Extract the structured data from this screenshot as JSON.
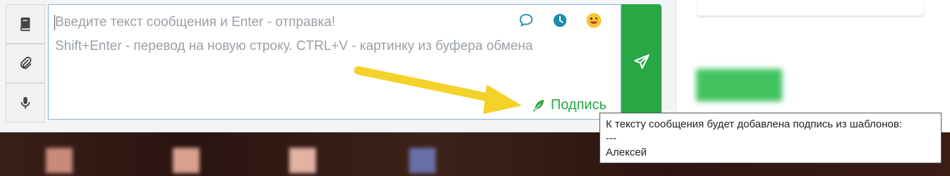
{
  "composer": {
    "placeholder_line1": "Введите текст сообщения и Enter - отправка!",
    "placeholder_line2": "Shift+Enter - перевод на новую строку. CTRL+V - картинку из буфера обмена",
    "signature_label": "Подпись"
  },
  "left_tools": [
    {
      "name": "template-book-icon"
    },
    {
      "name": "attach-paperclip-icon"
    },
    {
      "name": "microphone-icon"
    }
  ],
  "top_icons": [
    "chat-bubble-icon",
    "clock-icon",
    "emoji-icon"
  ],
  "tooltip": {
    "line1": "К тексту сообщения будет добавлена подпись из шаблонов:",
    "line2": "---",
    "line3": "Алексей"
  },
  "colors": {
    "send_button": "#28a745",
    "signature": "#27a844",
    "icon_teal": "#1b8bb0",
    "arrow": "#f5d22a"
  }
}
